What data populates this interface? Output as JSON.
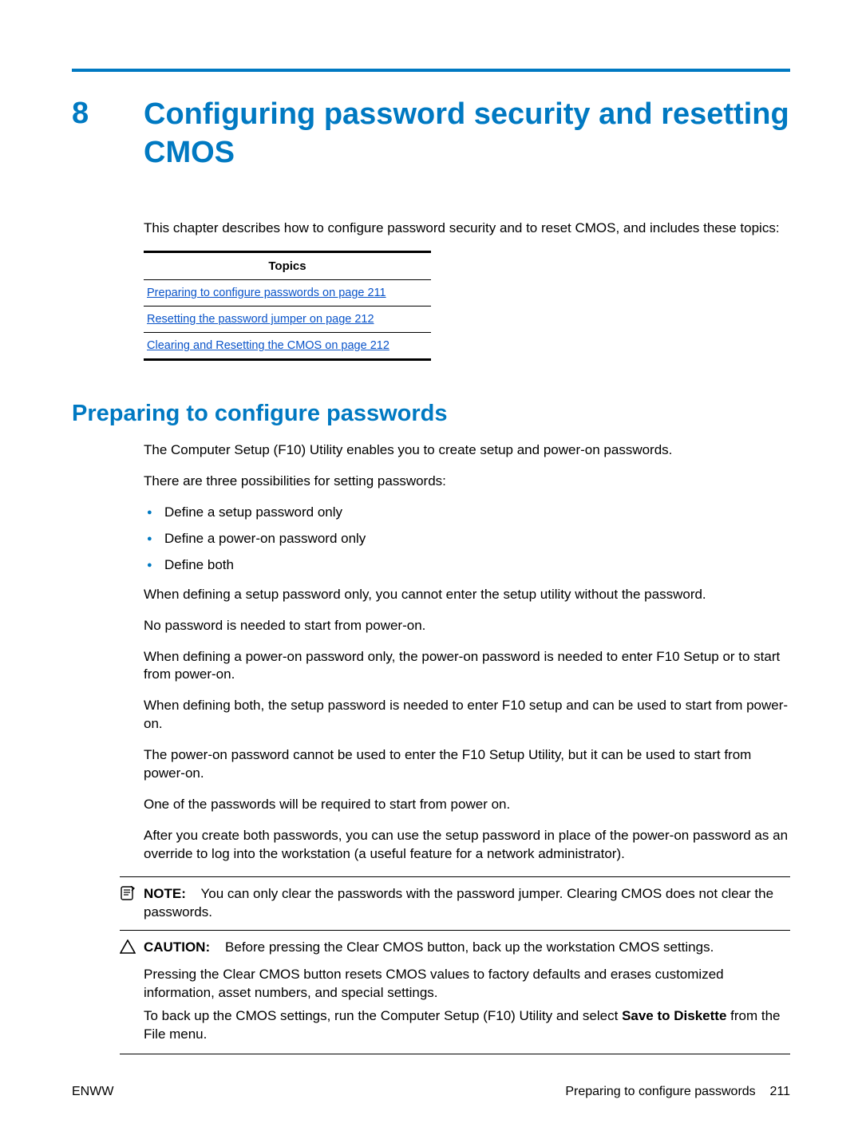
{
  "chapter": {
    "number": "8",
    "title": "Configuring password security and resetting CMOS"
  },
  "intro": "This chapter describes how to configure password security and to reset CMOS, and includes these topics:",
  "topics": {
    "header": "Topics",
    "items": [
      "Preparing to configure passwords on page 211",
      "Resetting the password jumper on page 212",
      "Clearing and Resetting the CMOS on page 212"
    ]
  },
  "section": {
    "heading": "Preparing to configure passwords",
    "p1": "The Computer Setup (F10) Utility enables you to create setup and power-on passwords.",
    "p2": "There are three possibilities for setting passwords:",
    "bullets": [
      "Define a setup password only",
      "Define a power-on password only",
      "Define both"
    ],
    "p3": "When defining a setup password only, you cannot enter the setup utility without the password.",
    "p4": "No password is needed to start from power-on.",
    "p5": "When defining a power-on password only, the power-on password is needed to enter F10 Setup or to start from power-on.",
    "p6": "When defining both, the setup password is needed to enter F10 setup and can be used to start from power-on.",
    "p7": "The power-on password cannot be used to enter the F10 Setup Utility, but it can be used to start from power-on.",
    "p8": "One of the passwords will be required to start from power on.",
    "p9": "After you create both passwords, you can use the setup password in place of the power-on password as an override to log into the workstation (a useful feature for a network administrator)."
  },
  "note": {
    "label": "NOTE:",
    "text": "You can only clear the passwords with the password jumper. Clearing CMOS does not clear the passwords."
  },
  "caution": {
    "label": "CAUTION:",
    "lead": "Before pressing the Clear CMOS button, back up the workstation CMOS settings.",
    "p1": "Pressing the Clear CMOS button resets CMOS values to factory defaults and erases customized information, asset numbers, and special settings.",
    "p2_pre": "To back up the CMOS settings, run the Computer Setup (F10) Utility and select ",
    "p2_bold": "Save to Diskette",
    "p2_post": " from the File menu."
  },
  "footer": {
    "left": "ENWW",
    "right_text": "Preparing to configure passwords",
    "page_num": "211"
  }
}
